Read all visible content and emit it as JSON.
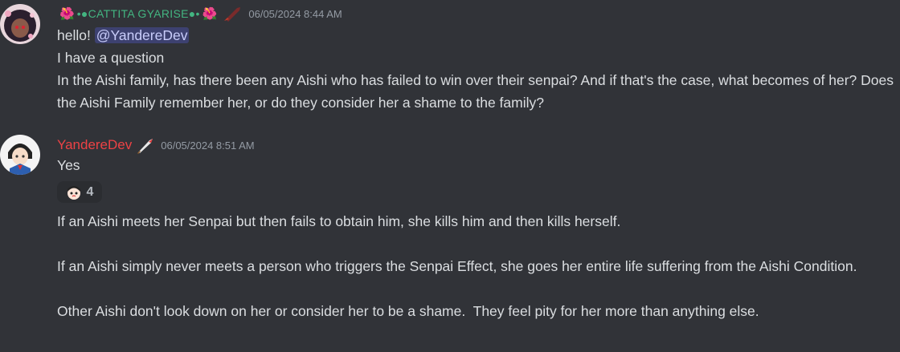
{
  "messages": [
    {
      "author": "•●CATTITA GYARISE●•",
      "timestamp": "06/05/2024 8:44 AM",
      "lines": {
        "greeting": "hello!",
        "mention": "@YandereDev",
        "line2": "I have a question",
        "line3": "In the Aishi family, has there been any Aishi who has failed to win over their senpai? And if that's the case, what becomes of her? Does the Aishi Family remember her, or do they consider her a shame to the family?"
      }
    },
    {
      "author": "YandereDev",
      "timestamp": "06/05/2024 8:51 AM",
      "text1": "Yes",
      "reaction": {
        "icon": "chibi-face-emoji",
        "count": "4"
      },
      "para1": "If an Aishi meets her Senpai but then fails to obtain him, she kills him and then kills herself.",
      "para2": "If an Aishi simply never meets a person who triggers the Senpai Effect, she goes her entire life suffering from the Aishi Condition.",
      "para3": "Other Aishi don't look down on her or consider her to be a shame.  They feel pity for her more than anything else."
    }
  ],
  "colors": {
    "background": "#313338",
    "text": "#dbdee1",
    "timestamp": "#949ba4",
    "author1": "#43b581",
    "author2": "#ed4245",
    "mention_bg": "#3c4270"
  }
}
